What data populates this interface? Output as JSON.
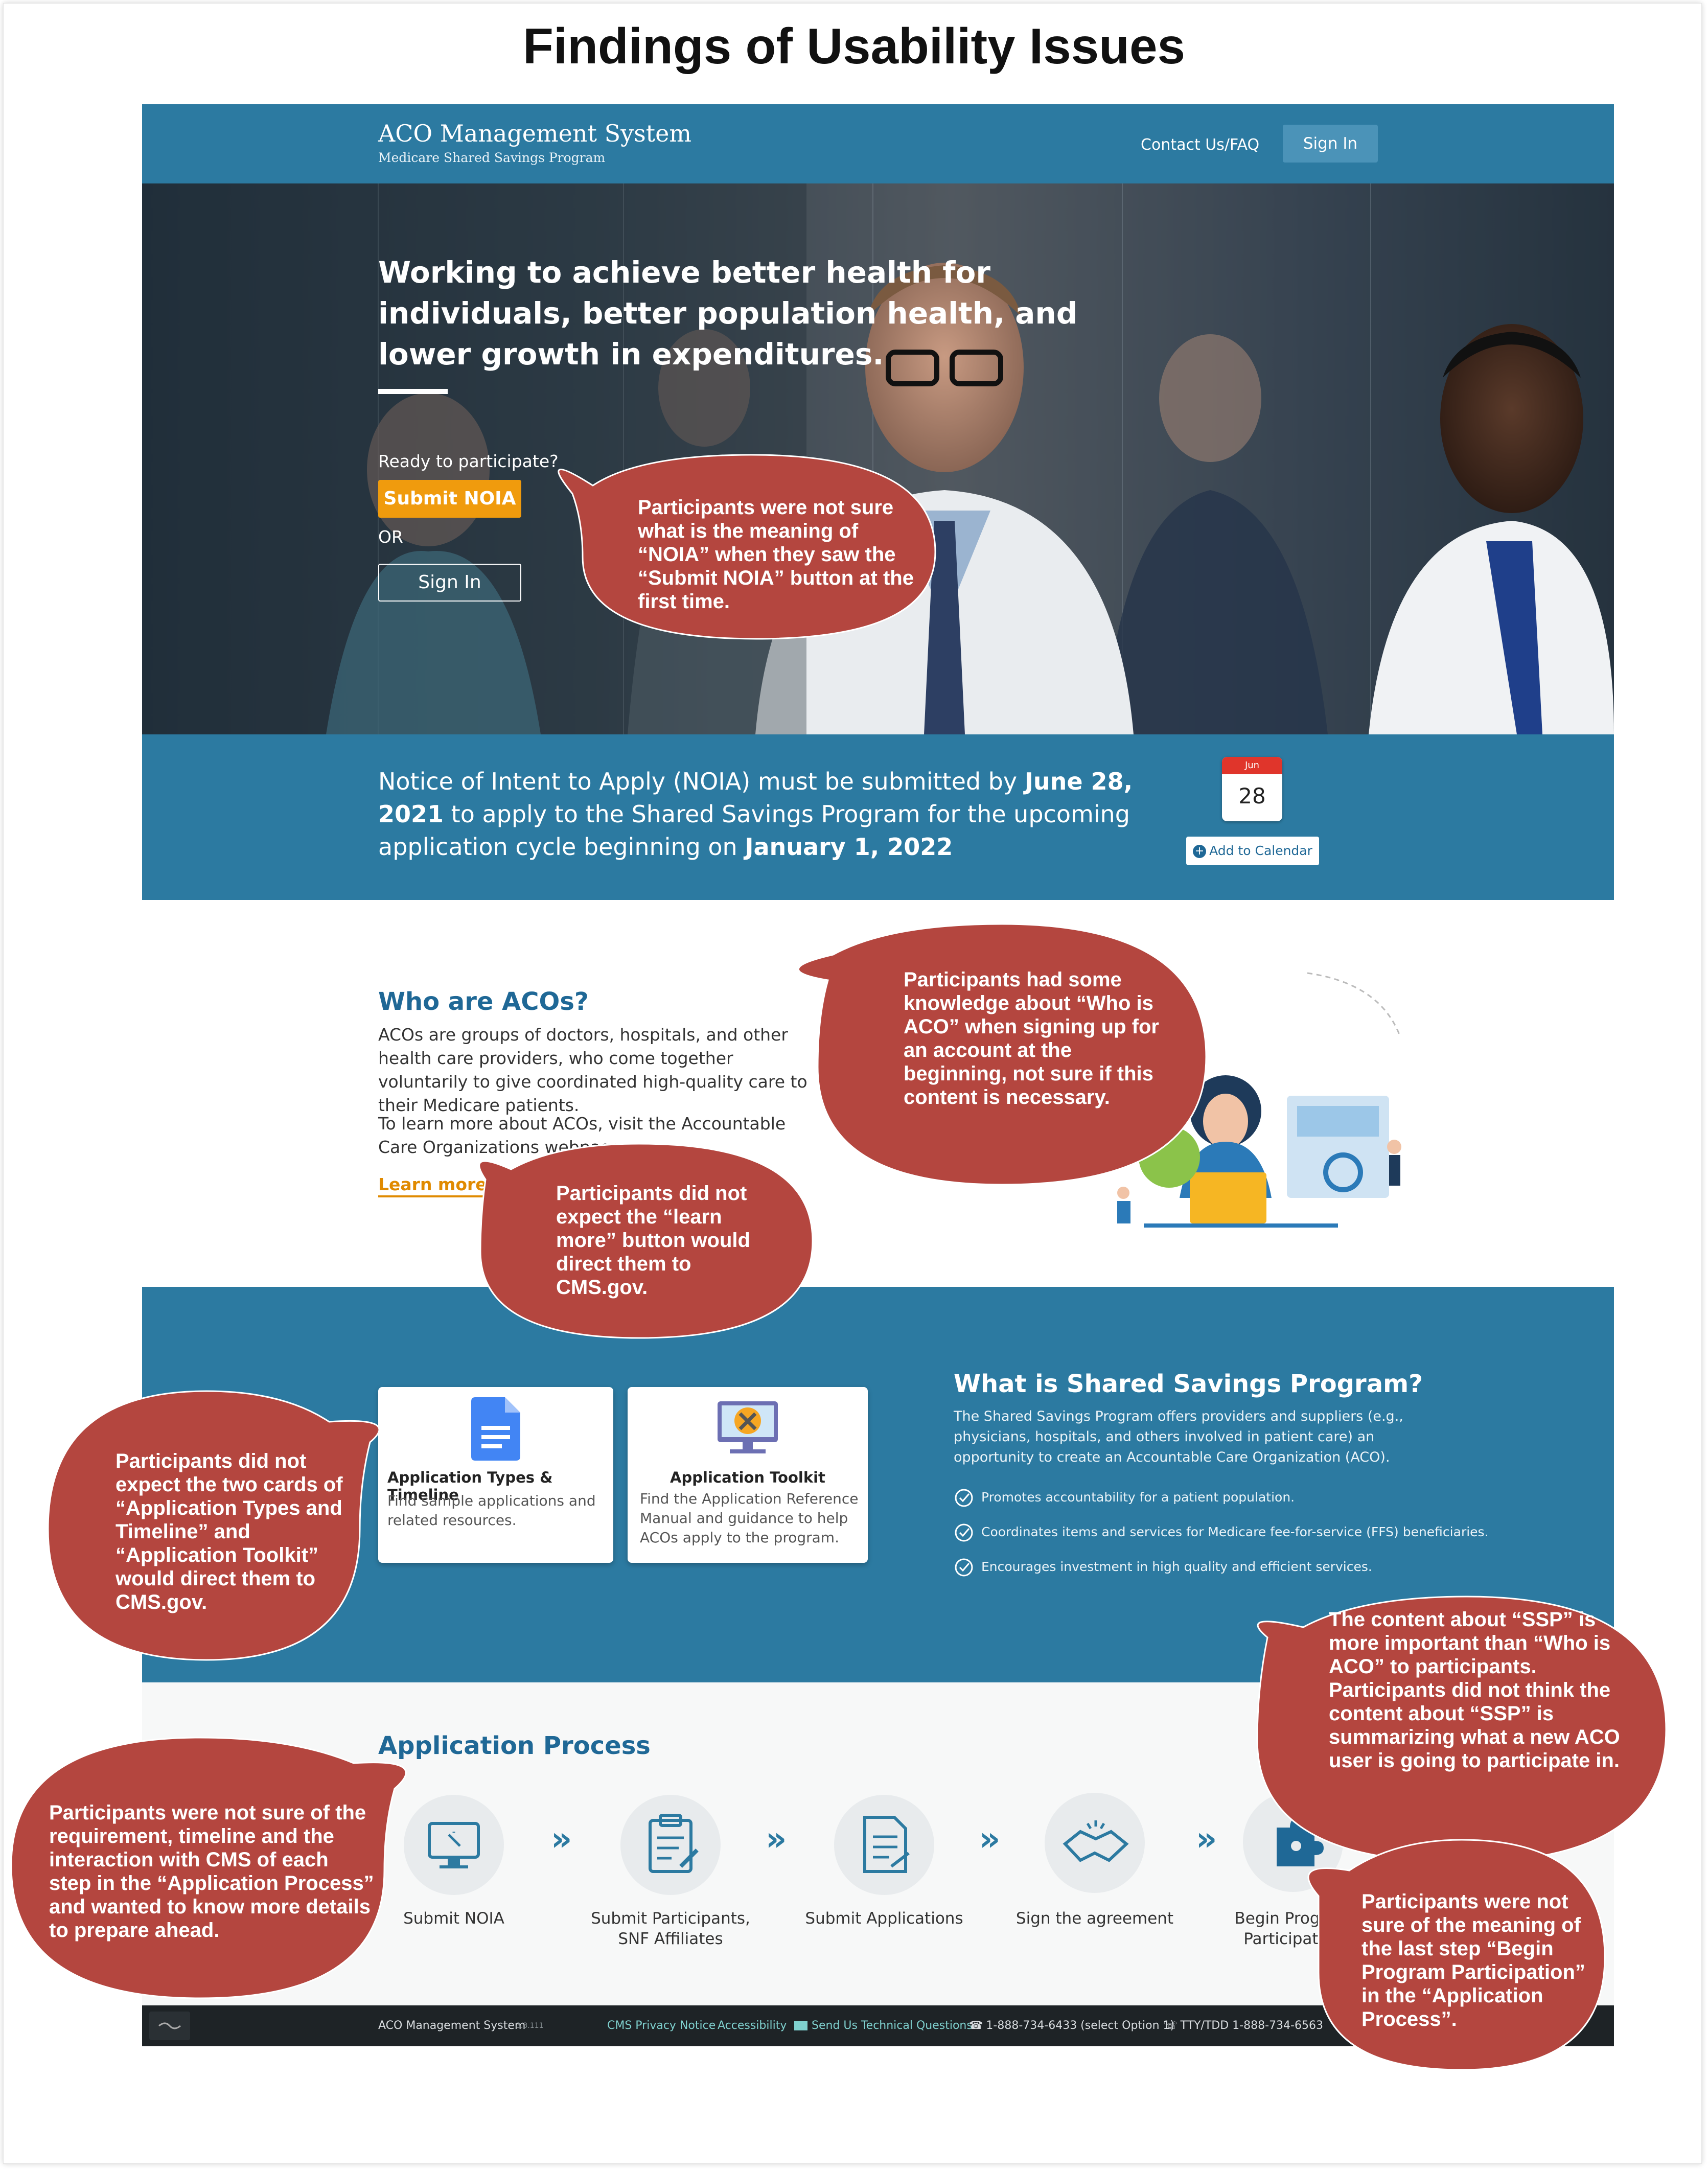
{
  "page_title": "Findings of Usability Issues",
  "header": {
    "brand_title": "ACO Management System",
    "brand_subtitle": "Medicare Shared Savings Program",
    "contact_link": "Contact Us/FAQ",
    "signin_button": "Sign In"
  },
  "hero": {
    "headline": "Working to achieve better health for individuals, better population health, and lower growth in expenditures.",
    "ready_text": "Ready to participate?",
    "submit_noia_button": "Submit NOIA",
    "or_text": "OR",
    "signin_button": "Sign In"
  },
  "notice": {
    "text_a": "Notice of Intent to Apply (NOIA) must be submitted by ",
    "deadline": "June 28, 2021",
    "text_b": " to apply to the Shared Savings Program for the upcoming application cycle beginning on ",
    "start_date": "January 1, 2022",
    "calendar_month": "Jun",
    "calendar_day": "28",
    "add_to_calendar": "Add to Calendar"
  },
  "who": {
    "heading": "Who are ACOs?",
    "paragraph1": "ACOs are groups of doctors, hospitals, and other health care providers, who come together voluntarily to give coordinated high-quality care to their Medicare patients.",
    "paragraph2": "To learn more about ACOs, visit the Accountable Care Organizations webpage.",
    "learn_more": "Learn more"
  },
  "cards": [
    {
      "title": "Application Types & Timeline",
      "description": "Find sample applications and related resources.",
      "icon": "document-icon"
    },
    {
      "title": "Application Toolkit",
      "description": "Find the Application Reference Manual and guidance to help ACOs apply to the program.",
      "icon": "toolkit-icon"
    }
  ],
  "ssp": {
    "heading": "What is Shared Savings Program?",
    "paragraph": "The Shared Savings Program offers providers and suppliers (e.g., physicians, hospitals, and others involved in patient care) an opportunity to create an Accountable Care Organization (ACO).",
    "bullets": [
      "Promotes accountability for a patient population.",
      "Coordinates items and services for Medicare fee-for-service (FFS) beneficiaries.",
      "Encourages investment in high quality and efficient services."
    ]
  },
  "process": {
    "heading": "Application Process",
    "steps": [
      {
        "label": "Submit NOIA",
        "icon": "monitor-icon"
      },
      {
        "label": "Submit Participants, SNF Affiliates",
        "icon": "clipboard-icon"
      },
      {
        "label": "Submit Applications",
        "icon": "document-edit-icon"
      },
      {
        "label": "Sign the agreement",
        "icon": "handshake-icon"
      },
      {
        "label": "Begin Program Participation",
        "icon": "puzzle-icon"
      }
    ]
  },
  "footer": {
    "app_name": "ACO Management System",
    "version": "3.3.111",
    "privacy": "CMS Privacy Notice",
    "accessibility": "Accessibility",
    "tech_questions": "Send Us Technical Questions",
    "phone": "1-888-734-6433 (select Option 1)",
    "tty": "TTY/TDD 1-888-734-6563"
  },
  "annotations": [
    {
      "text": "Participants were not sure what is the meaning of “NOIA” when they saw the “Submit NOIA” button at the first time."
    },
    {
      "text": "Participants had some knowledge about “Who is ACO” when signing up for an account at the beginning, not sure if this content is necessary."
    },
    {
      "text": "Participants did not expect the “learn more” button would direct them to CMS.gov."
    },
    {
      "text": "Participants did not expect the two cards of “Application Types and Timeline” and “Application Toolkit” would direct them to CMS.gov."
    },
    {
      "text": "The content about “SSP” is more important than “Who is ACO” to participants. Participants did not think the content about “SSP” is summarizing what a new ACO user is going to participate in."
    },
    {
      "text": "Participants were not sure of the requirement, timeline and the interaction with CMS of each step in the “Application Process” and wanted to know more details to prepare ahead."
    },
    {
      "text": "Participants were not sure of the meaning of the last step “Begin Program Participation” in the “Application Process”."
    }
  ],
  "colors": {
    "brand_blue": "#2c7aa1",
    "heading_blue": "#1f6896",
    "accent_orange": "#f09b0d",
    "bubble_red": "#b4463f",
    "footer_dark": "#1e2326"
  }
}
